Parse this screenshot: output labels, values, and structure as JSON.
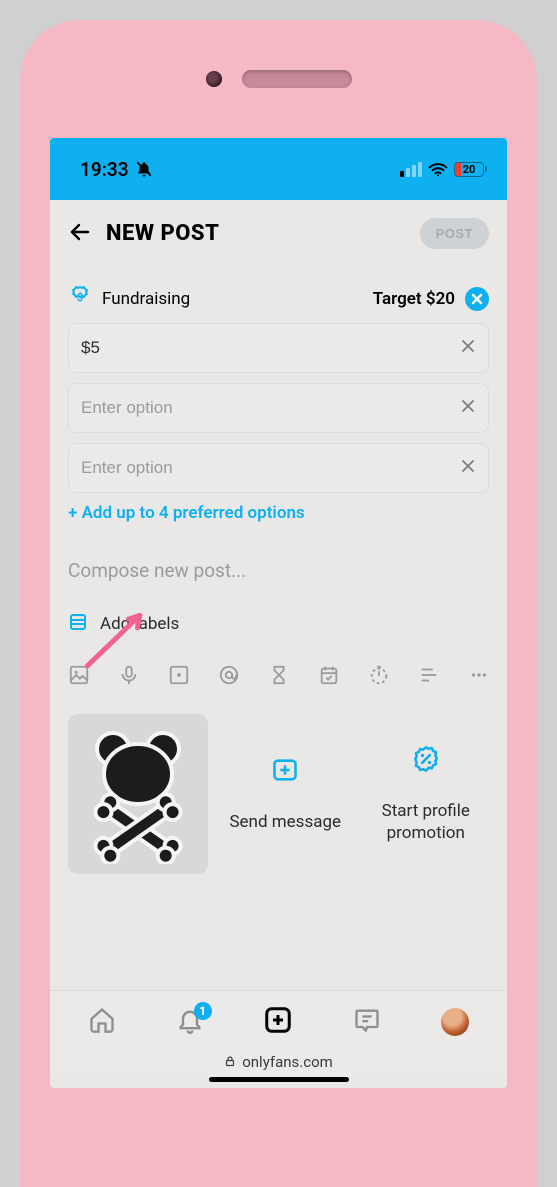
{
  "status": {
    "time": "19:33",
    "battery_pct": "20"
  },
  "header": {
    "title": "NEW POST",
    "post_btn": "POST"
  },
  "fundraising": {
    "label": "Fundraising",
    "target_text": "Target $20",
    "options": [
      {
        "value": "$5",
        "placeholder": ""
      },
      {
        "value": "",
        "placeholder": "Enter option"
      },
      {
        "value": "",
        "placeholder": "Enter option"
      }
    ],
    "add_link": "+ Add up to 4 preferred options"
  },
  "compose": {
    "placeholder": "Compose new post..."
  },
  "labels": {
    "text": "Add labels"
  },
  "actions": {
    "send_message": "Send message",
    "promotion": "Start profile promotion"
  },
  "nav": {
    "notif_badge": "1"
  },
  "url_bar": {
    "domain": "onlyfans.com"
  }
}
